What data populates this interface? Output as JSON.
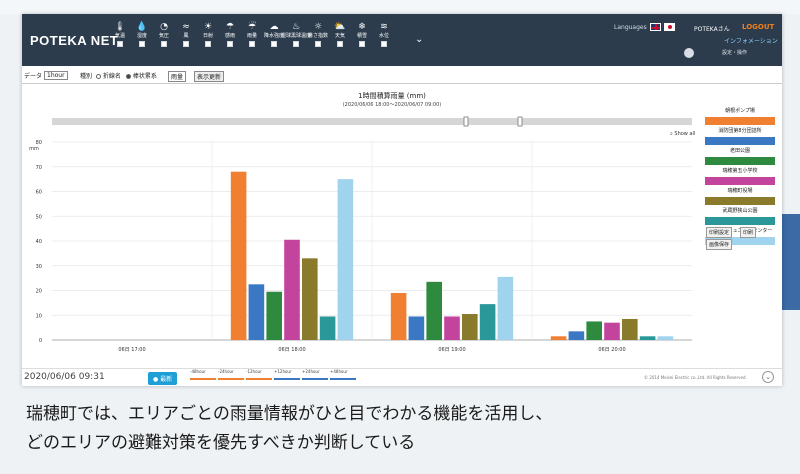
{
  "nav": {
    "logo": "POTEKA NET",
    "items": [
      {
        "label": "気温",
        "icon": "thermometer-icon",
        "glyph": "🌡"
      },
      {
        "label": "湿度",
        "icon": "humidity-icon",
        "glyph": "💧"
      },
      {
        "label": "気圧",
        "icon": "pressure-icon",
        "glyph": "◔"
      },
      {
        "label": "風",
        "icon": "wind-icon",
        "glyph": "≈"
      },
      {
        "label": "日射",
        "icon": "sun-icon",
        "glyph": "☀"
      },
      {
        "label": "感雨",
        "icon": "umbrella-icon",
        "glyph": "☂"
      },
      {
        "label": "雨量",
        "icon": "rain-icon",
        "glyph": "☔"
      },
      {
        "label": "降水強度",
        "icon": "rain-intensity-icon",
        "glyph": "☁"
      },
      {
        "label": "湿球黒球温度",
        "icon": "wbgt-icon",
        "glyph": "♨"
      },
      {
        "label": "暑さ指数",
        "icon": "heat-index-icon",
        "glyph": "☼"
      },
      {
        "label": "天気",
        "icon": "weather-icon",
        "glyph": "⛅"
      },
      {
        "label": "積雪",
        "icon": "snow-icon",
        "glyph": "❄"
      },
      {
        "label": "水位",
        "icon": "water-level-icon",
        "glyph": "≋"
      }
    ],
    "languages_label": "Languages",
    "user": "POTEKAさん",
    "logout": "LOGOUT",
    "info_link": "インフォメーション",
    "settings": "設定・操作"
  },
  "toolbar": {
    "data_label": "データ",
    "interval": "1hour",
    "type_label": "種別",
    "radio_bar": "折線名",
    "radio_line": "棒状累系",
    "select_value": "雨量",
    "update_button": "表示更新"
  },
  "chart_data": {
    "type": "bar",
    "title": "1時間積算雨量 (mm)",
    "subtitle": "(2020/06/06 18:00〜2020/06/07 09:00)",
    "ylabel": "mm",
    "ylim": [
      0,
      80
    ],
    "yticks": [
      0,
      10,
      20,
      30,
      40,
      50,
      60,
      70,
      80
    ],
    "categories": [
      "06日 17:00",
      "06日 18:00",
      "06日 19:00",
      "06日 20:00"
    ],
    "series": [
      {
        "name": "朝根ポンプ場",
        "color": "#f07f32",
        "values": [
          0,
          68,
          19,
          1.5
        ]
      },
      {
        "name": "消防団第8分団詰所",
        "color": "#3a78c4",
        "values": [
          0,
          22.5,
          9.5,
          3.5
        ]
      },
      {
        "name": "老田公園",
        "color": "#2e8a3e",
        "values": [
          0,
          19.5,
          23.5,
          7.5
        ]
      },
      {
        "name": "瑞穂第五小学校",
        "color": "#c2449c",
        "values": [
          0,
          40.5,
          9.5,
          7
        ]
      },
      {
        "name": "瑞穂町役場",
        "color": "#8a7a2c",
        "values": [
          0,
          33,
          10.5,
          8.5
        ]
      },
      {
        "name": "武蔵野狭山公園",
        "color": "#2a9898",
        "values": [
          0,
          9.5,
          14.5,
          1.5
        ]
      },
      {
        "name": "元狭山コミュニティセンター",
        "color": "#9fd3ee",
        "values": [
          0,
          65,
          25.5,
          1.5
        ]
      }
    ],
    "legend": "right",
    "show_all": "Show all",
    "grid": true
  },
  "side_buttons": {
    "print_settings": "印刷設定",
    "print": "印刷",
    "save_image": "画像保存"
  },
  "bottom": {
    "datetime": "2020/06/06  09:31",
    "latest": "最新",
    "timeline": [
      "-48hour",
      "-24hour",
      "-12hour",
      "+12hour",
      "+24hour",
      "+48hour"
    ],
    "timeline_colors": [
      "#f07f32",
      "#f07f32",
      "#f07f32",
      "#3a78c4",
      "#3a78c4",
      "#3a78c4"
    ],
    "copyright": "© 2014 Meisei Electric co.,Ltd. All Rights Reserved."
  },
  "caption": {
    "line1": "瑞穂町では、エリアごとの雨量情報がひと目でわかる機能を活用し、",
    "line2": "どのエリアの避難対策を優先すべきか判断している"
  }
}
